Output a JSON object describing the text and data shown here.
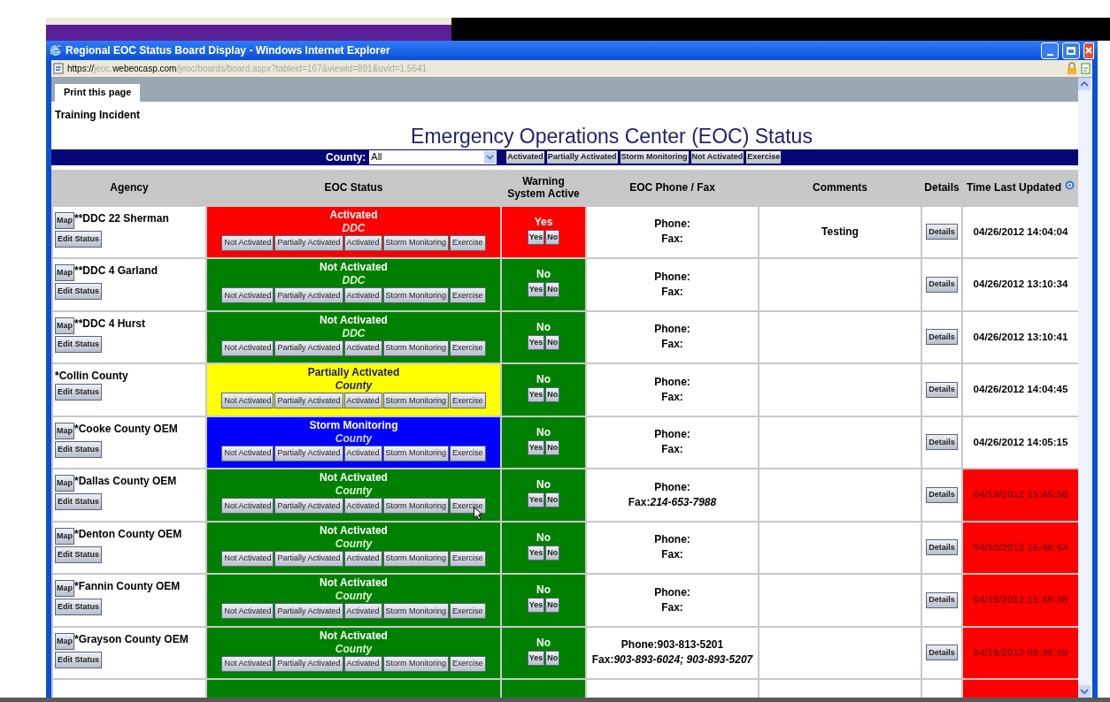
{
  "window": {
    "title": "Regional EOC Status Board Display - Windows Internet Explorer"
  },
  "address": {
    "scheme": "https://",
    "host_prefix": "jeoc.",
    "host": "webeocasp.com",
    "path": "/jeoc/boards/board.aspx?tableid=167&viewid=891&uvid=1.5641"
  },
  "page_tab": {
    "label": "Print this page",
    "selected": true
  },
  "incident": "Training Incident",
  "heading": "Emergency Operations Center (EOC) Status",
  "filter": {
    "label": "County:",
    "value": "All",
    "buttons": [
      "Activated",
      "Partially Activated",
      "Storm Monitoring",
      "Not Activated",
      "Exercise"
    ]
  },
  "table": {
    "columns": [
      "Agency",
      "EOC Status",
      "Warning System Active",
      "EOC Phone / Fax",
      "Comments",
      "Details",
      "Time Last Updated"
    ],
    "rows": [
      {
        "map": "Map",
        "agency": "**DDC 22 Sherman",
        "edit": "Edit Status",
        "status": "Activated",
        "type": "DDC",
        "color": "#ff0000",
        "buttons": [
          "Not Activated",
          "Partially Activated",
          "Activated",
          "Storm Monitoring",
          "Exercise"
        ],
        "warning": "Yes",
        "warning_active": true,
        "yes_no": [
          "Yes",
          "No"
        ],
        "phone": "Phone:",
        "fax": "Fax:",
        "comments": "Testing",
        "details": "Details",
        "time": "04/26/2012 14:04:04",
        "stale": false
      },
      {
        "map": "Map",
        "agency": "**DDC 4 Garland",
        "edit": "Edit Status",
        "status": "Not Activated",
        "type": "DDC",
        "color": "#008000",
        "buttons": [
          "Not Activated",
          "Partially Activated",
          "Activated",
          "Storm Monitoring",
          "Exercise"
        ],
        "warning": "No",
        "warning_active": false,
        "yes_no": [
          "Yes",
          "No"
        ],
        "phone": "Phone:",
        "fax": "Fax:",
        "details": "Details",
        "time": "04/26/2012 13:10:34",
        "stale": false
      },
      {
        "map": "Map",
        "agency": "**DDC 4 Hurst",
        "edit": "Edit Status",
        "status": "Not Activated",
        "type": "DDC",
        "color": "#008000",
        "buttons": [
          "Not Activated",
          "Partially Activated",
          "Activated",
          "Storm Monitoring",
          "Exercise"
        ],
        "warning": "No",
        "warning_active": false,
        "yes_no": [
          "Yes",
          "No"
        ],
        "phone": "Phone:",
        "fax": "Fax:",
        "details": "Details",
        "time": "04/26/2012 13:10:41",
        "stale": false
      },
      {
        "agency": "*Collin County",
        "edit": "Edit Status",
        "status": "Partially Activated",
        "type": "County",
        "color": "#ffff00",
        "buttons": [
          "Not Activated",
          "Partially Activated",
          "Activated",
          "Storm Monitoring",
          "Exercise"
        ],
        "warning": "No",
        "warning_active": false,
        "yes_no": [
          "Yes",
          "No"
        ],
        "phone": "Phone:",
        "fax": "Fax:",
        "details": "Details",
        "time": "04/26/2012 14:04:45",
        "stale": false
      },
      {
        "map": "Map",
        "agency": "*Cooke County OEM",
        "edit": "Edit Status",
        "status": "Storm Monitoring",
        "type": "County",
        "color": "#0000ff",
        "buttons": [
          "Not Activated",
          "Partially Activated",
          "Activated",
          "Storm Monitoring",
          "Exercise"
        ],
        "warning": "No",
        "warning_active": false,
        "yes_no": [
          "Yes",
          "No"
        ],
        "phone": "Phone:",
        "fax": "Fax:",
        "details": "Details",
        "time": "04/26/2012 14:05:15",
        "stale": false
      },
      {
        "map": "Map",
        "agency": "*Dallas County OEM",
        "edit": "Edit Status",
        "status": "Not Activated",
        "type": "County",
        "color": "#008000",
        "buttons": [
          "Not Activated",
          "Partially Activated",
          "Activated",
          "Storm Monitoring",
          "Exercise"
        ],
        "warning": "No",
        "warning_active": false,
        "yes_no": [
          "Yes",
          "No"
        ],
        "phone": "Phone:",
        "fax": "Fax:*214-653-7988*",
        "details": "Details",
        "time": "04/19/2012 15:45:58",
        "stale": true
      },
      {
        "map": "Map",
        "agency": "*Denton County OEM",
        "edit": "Edit Status",
        "status": "Not Activated",
        "type": "County",
        "color": "#008000",
        "buttons": [
          "Not Activated",
          "Partially Activated",
          "Activated",
          "Storm Monitoring",
          "Exercise"
        ],
        "warning": "No",
        "warning_active": false,
        "yes_no": [
          "Yes",
          "No"
        ],
        "phone": "Phone:",
        "fax": "Fax:",
        "details": "Details",
        "time": "04/10/2012 15:46:53",
        "stale": true
      },
      {
        "map": "Map",
        "agency": "*Fannin County OEM",
        "edit": "Edit Status",
        "status": "Not Activated",
        "type": "County",
        "color": "#008000",
        "buttons": [
          "Not Activated",
          "Partially Activated",
          "Activated",
          "Storm Monitoring",
          "Exercise"
        ],
        "warning": "No",
        "warning_active": false,
        "yes_no": [
          "Yes",
          "No"
        ],
        "phone": "Phone:",
        "fax": "Fax:",
        "details": "Details",
        "time": "04/19/2012 15:49:38",
        "stale": true
      },
      {
        "map": "Map",
        "agency": "*Grayson County OEM",
        "edit": "Edit Status",
        "status": "Not Activated",
        "type": "County",
        "color": "#008000",
        "buttons": [
          "Not Activated",
          "Partially Activated",
          "Activated",
          "Storm Monitoring",
          "Exercise"
        ],
        "warning": "No",
        "warning_active": false,
        "yes_no": [
          "Yes",
          "No"
        ],
        "phone": "Phone:903-813-5201",
        "fax": "Fax:*903-893-6024; 903-893-5207*",
        "details": "Details",
        "time": "04/18/2012 08:38:59",
        "stale": true
      }
    ]
  }
}
